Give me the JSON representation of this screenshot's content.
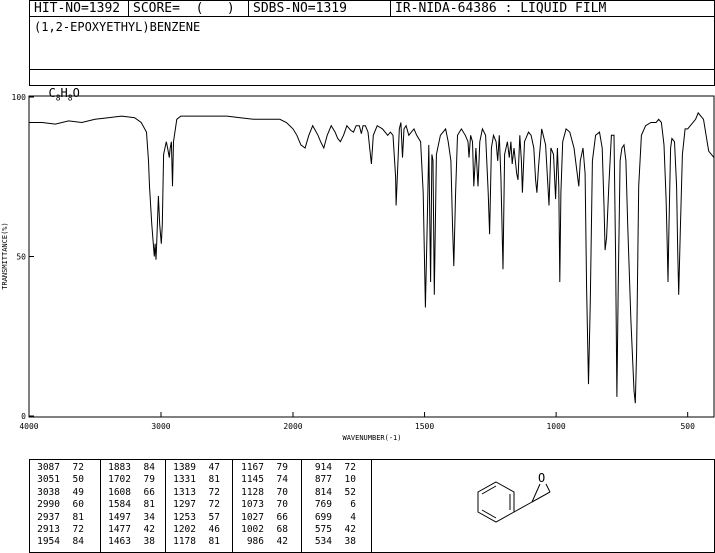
{
  "header": {
    "hit_no": "HIT-NO=1392",
    "score": "SCORE=  (   )",
    "sdbs_no": "SDBS-NO=1319",
    "ir_id": "IR-NIDA-64386 : LIQUID FILM"
  },
  "compound": {
    "name": "(1,2-EPOXYETHYL)BENZENE",
    "formula_parts": [
      "C",
      "8",
      "H",
      "8",
      "O"
    ]
  },
  "chart_data": {
    "type": "line",
    "xlabel": "WAVENUMBER(-1)",
    "ylabel": "TRANSMITTANCE(%)",
    "xlim": [
      4000,
      400
    ],
    "ylim": [
      0,
      100
    ],
    "x_ticks": [
      4000,
      3000,
      2000,
      1500,
      1000,
      500
    ],
    "y_ticks": [
      0,
      50,
      100
    ],
    "series": [
      {
        "points": [
          [
            4000,
            92
          ],
          [
            3900,
            92
          ],
          [
            3800,
            91.5
          ],
          [
            3700,
            92.5
          ],
          [
            3600,
            92
          ],
          [
            3500,
            93
          ],
          [
            3400,
            93.5
          ],
          [
            3300,
            94
          ],
          [
            3200,
            93.5
          ],
          [
            3150,
            92
          ],
          [
            3110,
            89
          ],
          [
            3095,
            80
          ],
          [
            3087,
            72
          ],
          [
            3070,
            60
          ],
          [
            3051,
            50
          ],
          [
            3045,
            54
          ],
          [
            3038,
            49
          ],
          [
            3032,
            55
          ],
          [
            3020,
            69
          ],
          [
            3010,
            60
          ],
          [
            2998,
            54
          ],
          [
            2990,
            60
          ],
          [
            2980,
            82
          ],
          [
            2960,
            86
          ],
          [
            2950,
            84
          ],
          [
            2937,
            81
          ],
          [
            2930,
            84
          ],
          [
            2921,
            86
          ],
          [
            2913,
            72
          ],
          [
            2905,
            86
          ],
          [
            2880,
            93
          ],
          [
            2850,
            94
          ],
          [
            2800,
            94
          ],
          [
            2700,
            94
          ],
          [
            2600,
            94
          ],
          [
            2500,
            94
          ],
          [
            2400,
            93.5
          ],
          [
            2300,
            93
          ],
          [
            2200,
            93
          ],
          [
            2100,
            93
          ],
          [
            2050,
            92
          ],
          [
            2000,
            90
          ],
          [
            1985,
            88
          ],
          [
            1970,
            85
          ],
          [
            1954,
            84
          ],
          [
            1940,
            88
          ],
          [
            1925,
            91
          ],
          [
            1905,
            88
          ],
          [
            1895,
            86
          ],
          [
            1883,
            84
          ],
          [
            1870,
            88
          ],
          [
            1855,
            91
          ],
          [
            1840,
            89
          ],
          [
            1830,
            87
          ],
          [
            1820,
            86
          ],
          [
            1808,
            88
          ],
          [
            1795,
            91
          ],
          [
            1780,
            89.5
          ],
          [
            1770,
            89
          ],
          [
            1760,
            91
          ],
          [
            1748,
            91
          ],
          [
            1740,
            88.5
          ],
          [
            1734,
            91
          ],
          [
            1725,
            91
          ],
          [
            1715,
            89
          ],
          [
            1702,
            79
          ],
          [
            1695,
            88
          ],
          [
            1680,
            91
          ],
          [
            1660,
            90
          ],
          [
            1640,
            88
          ],
          [
            1630,
            89
          ],
          [
            1620,
            88
          ],
          [
            1610,
            75
          ],
          [
            1608,
            66
          ],
          [
            1604,
            74
          ],
          [
            1596,
            90
          ],
          [
            1590,
            92
          ],
          [
            1584,
            81
          ],
          [
            1578,
            90
          ],
          [
            1570,
            91
          ],
          [
            1560,
            88
          ],
          [
            1550,
            89
          ],
          [
            1540,
            90
          ],
          [
            1530,
            88
          ],
          [
            1515,
            86
          ],
          [
            1505,
            70
          ],
          [
            1497,
            34
          ],
          [
            1490,
            60
          ],
          [
            1484,
            85
          ],
          [
            1477,
            42
          ],
          [
            1472,
            82
          ],
          [
            1468,
            80
          ],
          [
            1463,
            38
          ],
          [
            1455,
            82
          ],
          [
            1440,
            88
          ],
          [
            1420,
            90
          ],
          [
            1410,
            86
          ],
          [
            1400,
            80
          ],
          [
            1394,
            60
          ],
          [
            1389,
            47
          ],
          [
            1382,
            70
          ],
          [
            1375,
            88
          ],
          [
            1360,
            90
          ],
          [
            1345,
            88
          ],
          [
            1335,
            86
          ],
          [
            1331,
            81
          ],
          [
            1325,
            88
          ],
          [
            1318,
            86
          ],
          [
            1313,
            72
          ],
          [
            1305,
            84
          ],
          [
            1297,
            72
          ],
          [
            1290,
            86
          ],
          [
            1280,
            90
          ],
          [
            1268,
            88
          ],
          [
            1258,
            70
          ],
          [
            1253,
            57
          ],
          [
            1246,
            84
          ],
          [
            1238,
            88
          ],
          [
            1228,
            86
          ],
          [
            1222,
            80
          ],
          [
            1216,
            88
          ],
          [
            1210,
            75
          ],
          [
            1202,
            46
          ],
          [
            1196,
            82
          ],
          [
            1185,
            86
          ],
          [
            1178,
            81
          ],
          [
            1172,
            86
          ],
          [
            1167,
            79
          ],
          [
            1160,
            84
          ],
          [
            1150,
            76
          ],
          [
            1145,
            74
          ],
          [
            1138,
            88
          ],
          [
            1132,
            80
          ],
          [
            1128,
            70
          ],
          [
            1120,
            86
          ],
          [
            1105,
            89
          ],
          [
            1095,
            88
          ],
          [
            1085,
            84
          ],
          [
            1078,
            74
          ],
          [
            1073,
            70
          ],
          [
            1067,
            78
          ],
          [
            1055,
            90
          ],
          [
            1040,
            85
          ],
          [
            1027,
            66
          ],
          [
            1020,
            84
          ],
          [
            1010,
            82
          ],
          [
            1002,
            68
          ],
          [
            995,
            84
          ],
          [
            990,
            72
          ],
          [
            986,
            42
          ],
          [
            982,
            70
          ],
          [
            975,
            86
          ],
          [
            962,
            90
          ],
          [
            948,
            89
          ],
          [
            932,
            84
          ],
          [
            920,
            76
          ],
          [
            914,
            72
          ],
          [
            908,
            80
          ],
          [
            898,
            84
          ],
          [
            890,
            76
          ],
          [
            884,
            40
          ],
          [
            877,
            10
          ],
          [
            870,
            36
          ],
          [
            862,
            80
          ],
          [
            850,
            88
          ],
          [
            835,
            89
          ],
          [
            825,
            84
          ],
          [
            818,
            66
          ],
          [
            814,
            52
          ],
          [
            808,
            56
          ],
          [
            800,
            72
          ],
          [
            790,
            88
          ],
          [
            780,
            88
          ],
          [
            774,
            50
          ],
          [
            769,
            6
          ],
          [
            764,
            40
          ],
          [
            757,
            80
          ],
          [
            750,
            84
          ],
          [
            742,
            85
          ],
          [
            735,
            80
          ],
          [
            728,
            60
          ],
          [
            716,
            30
          ],
          [
            704,
            8
          ],
          [
            699,
            4
          ],
          [
            694,
            20
          ],
          [
            686,
            72
          ],
          [
            676,
            88
          ],
          [
            660,
            91
          ],
          [
            640,
            92
          ],
          [
            620,
            92
          ],
          [
            610,
            93
          ],
          [
            600,
            92
          ],
          [
            590,
            85
          ],
          [
            582,
            68
          ],
          [
            578,
            54
          ],
          [
            575,
            42
          ],
          [
            571,
            60
          ],
          [
            565,
            84
          ],
          [
            560,
            87
          ],
          [
            550,
            86
          ],
          [
            542,
            72
          ],
          [
            538,
            52
          ],
          [
            534,
            38
          ],
          [
            528,
            58
          ],
          [
            520,
            82
          ],
          [
            510,
            90
          ],
          [
            500,
            90
          ],
          [
            490,
            91
          ],
          [
            470,
            93
          ],
          [
            460,
            95
          ],
          [
            450,
            94
          ],
          [
            440,
            93
          ],
          [
            430,
            88
          ],
          [
            420,
            83
          ],
          [
            410,
            82
          ],
          [
            400,
            81
          ]
        ]
      }
    ]
  },
  "peak_table": {
    "columns": [
      [
        [
          "3087",
          "72"
        ],
        [
          "3051",
          "50"
        ],
        [
          "3038",
          "49"
        ],
        [
          "2990",
          "60"
        ],
        [
          "2937",
          "81"
        ],
        [
          "2913",
          "72"
        ],
        [
          "1954",
          "84"
        ]
      ],
      [
        [
          "1883",
          "84"
        ],
        [
          "1702",
          "79"
        ],
        [
          "1608",
          "66"
        ],
        [
          "1584",
          "81"
        ],
        [
          "1497",
          "34"
        ],
        [
          "1477",
          "42"
        ],
        [
          "1463",
          "38"
        ]
      ],
      [
        [
          "1389",
          "47"
        ],
        [
          "1331",
          "81"
        ],
        [
          "1313",
          "72"
        ],
        [
          "1297",
          "72"
        ],
        [
          "1253",
          "57"
        ],
        [
          "1202",
          "46"
        ],
        [
          "1178",
          "81"
        ]
      ],
      [
        [
          "1167",
          "79"
        ],
        [
          "1145",
          "74"
        ],
        [
          "1128",
          "70"
        ],
        [
          "1073",
          "70"
        ],
        [
          "1027",
          "66"
        ],
        [
          "1002",
          "68"
        ],
        [
          "986",
          "42"
        ]
      ],
      [
        [
          "914",
          "72"
        ],
        [
          "877",
          "10"
        ],
        [
          "814",
          "52"
        ],
        [
          "769",
          "6"
        ],
        [
          "699",
          "4"
        ],
        [
          "575",
          "42"
        ],
        [
          "534",
          "38"
        ]
      ]
    ]
  }
}
